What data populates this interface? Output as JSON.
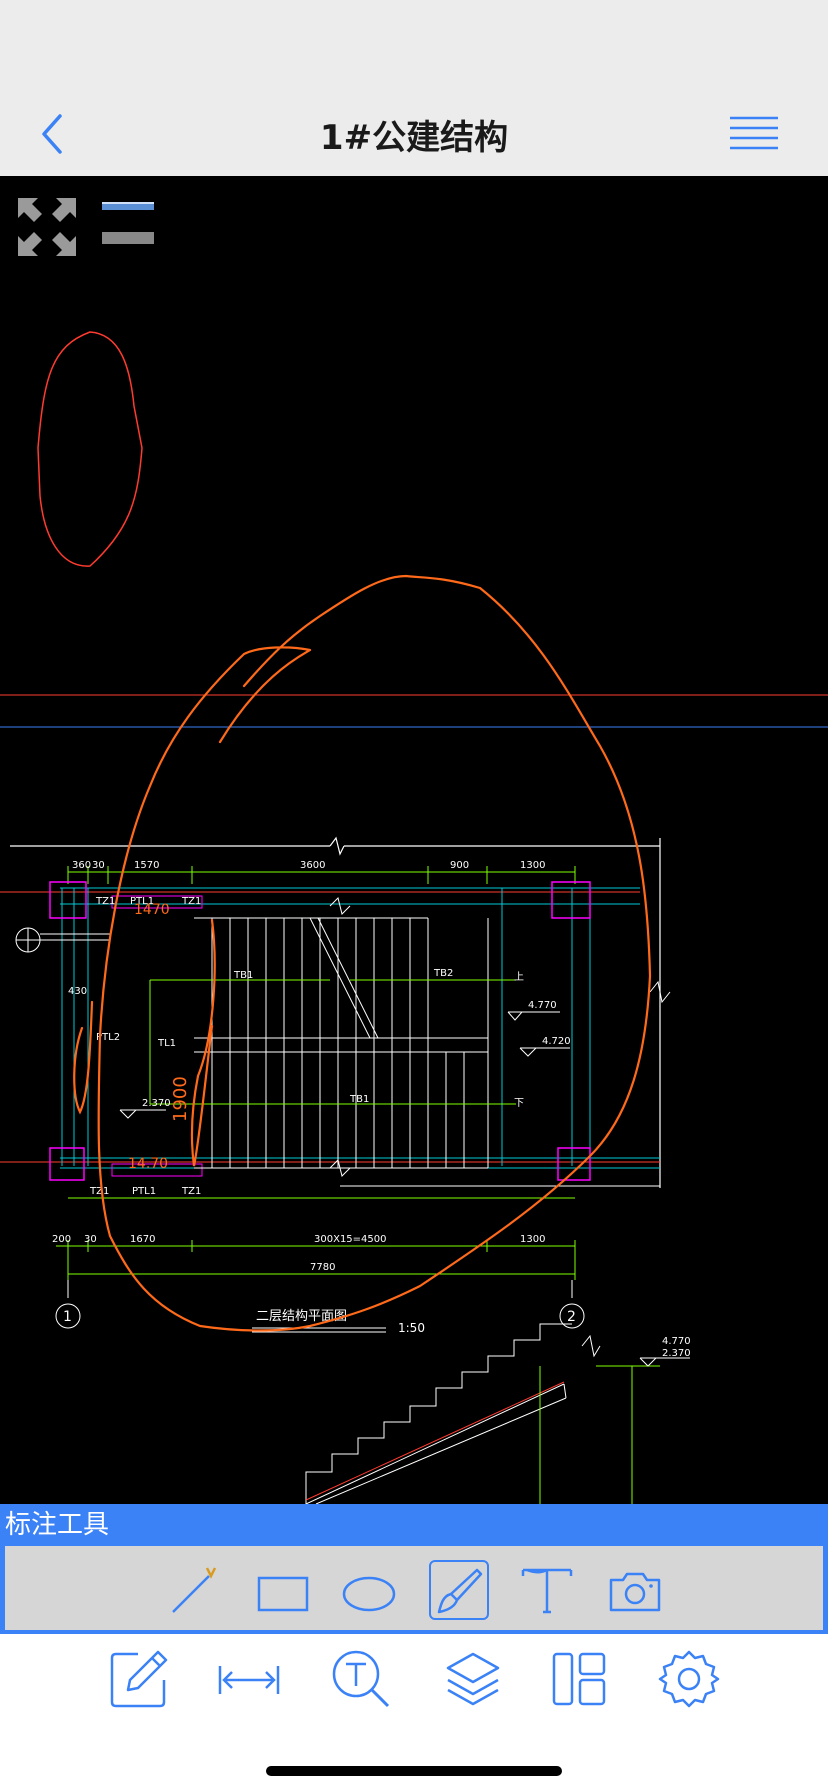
{
  "header": {
    "title": "1#公建结构",
    "back_icon": "chevron-left-icon",
    "menu_icon": "hamburger-menu-icon"
  },
  "drawing": {
    "dimension_top": [
      "360",
      "30",
      "1570",
      "3600",
      "900",
      "1300"
    ],
    "dimension_bottom": [
      "200",
      "30",
      "1670",
      "300X15=4500",
      "1300"
    ],
    "dimension_total": "7780",
    "labels": {
      "tz1_top_left": "TZ1",
      "ptl1_top": "PTL1",
      "tz1_top_right": "TZ1",
      "tz1_bottom_left": "TZ1",
      "ptl1_bottom": "PTL1",
      "tz1_bottom_right": "TZ1",
      "tb1_a": "TB1",
      "tb2": "TB2",
      "tb1_b": "TB1",
      "tl1": "TL1",
      "ptl2": "PTL2",
      "up": "上",
      "down": "下"
    },
    "elevations": {
      "e1470_top": "1470",
      "e1470_bottom": "14.70",
      "e4770": "4.770",
      "e4720": "4.720",
      "e2370": "2.370",
      "e1900": "1900",
      "side_430": "430",
      "section_4770": "4.770",
      "section_2370": "2.370"
    },
    "axes": [
      "1",
      "2"
    ],
    "plan_title": "二层结构平面图",
    "plan_scale": "1:50",
    "colors": {
      "annotation": "#ff6a1a",
      "dimension": "#7fff00",
      "outline": "#ffffff",
      "wall": "#00c8d6",
      "column": "#ff00ff",
      "red_line": "#ff3b30"
    }
  },
  "annotation_tools": {
    "header_label": "标注工具",
    "tools": [
      {
        "icon": "line-tool-icon",
        "active": false
      },
      {
        "icon": "rectangle-tool-icon",
        "active": false
      },
      {
        "icon": "ellipse-tool-icon",
        "active": false
      },
      {
        "icon": "brush-tool-icon",
        "active": true
      },
      {
        "icon": "text-tool-icon",
        "active": false
      },
      {
        "icon": "camera-tool-icon",
        "active": false
      }
    ]
  },
  "bottom_toolbar": [
    {
      "icon": "edit-icon"
    },
    {
      "icon": "measure-icon"
    },
    {
      "icon": "text-search-icon"
    },
    {
      "icon": "layers-icon"
    },
    {
      "icon": "layout-icon"
    },
    {
      "icon": "settings-icon"
    }
  ],
  "accent_color": "#3b82f6"
}
